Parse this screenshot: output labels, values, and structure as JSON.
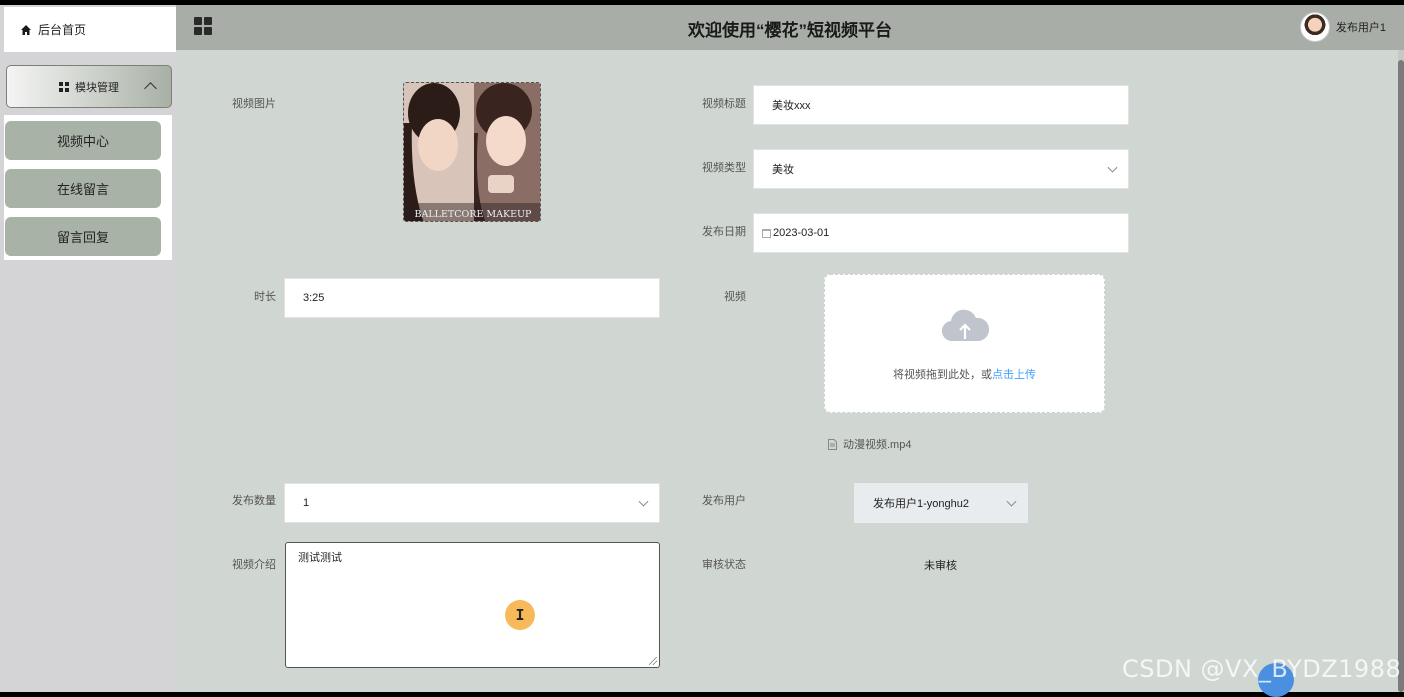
{
  "nav": {
    "home_label": "后台首页"
  },
  "header": {
    "title": "欢迎使用“樱花”短视频平台",
    "user_name": "发布用户1"
  },
  "sidebar": {
    "module_label": "模块管理",
    "items": [
      {
        "label": "视频中心"
      },
      {
        "label": "在线留言"
      },
      {
        "label": "留言回复"
      }
    ]
  },
  "form": {
    "video_image_label": "视频图片",
    "video_image_overlay_text": "BALLETCORE MAKEUP",
    "title_label": "视频标题",
    "title_value": "美妆xxx",
    "type_label": "视频类型",
    "type_value": "美妆",
    "date_label": "发布日期",
    "date_value": "2023-03-01",
    "duration_label": "时长",
    "duration_value": "3:25",
    "video_label": "视频",
    "upload_text": "将视频拖到此处，或",
    "upload_link": "点击上传",
    "file_name": "动漫视频.mp4",
    "count_label": "发布数量",
    "count_value": "1",
    "publisher_label": "发布用户",
    "publisher_value": "发布用户1-yonghu2",
    "intro_label": "视频介绍",
    "intro_value": "测试测试",
    "audit_label": "审核状态",
    "audit_value": "未审核"
  },
  "watermark": "CSDN @VX_BYDZ1988",
  "colors": {
    "sidebar_item": "#a9b2a6",
    "header": "#a8aea7",
    "main_bg": "#d0d6d2",
    "link": "#409eff"
  }
}
